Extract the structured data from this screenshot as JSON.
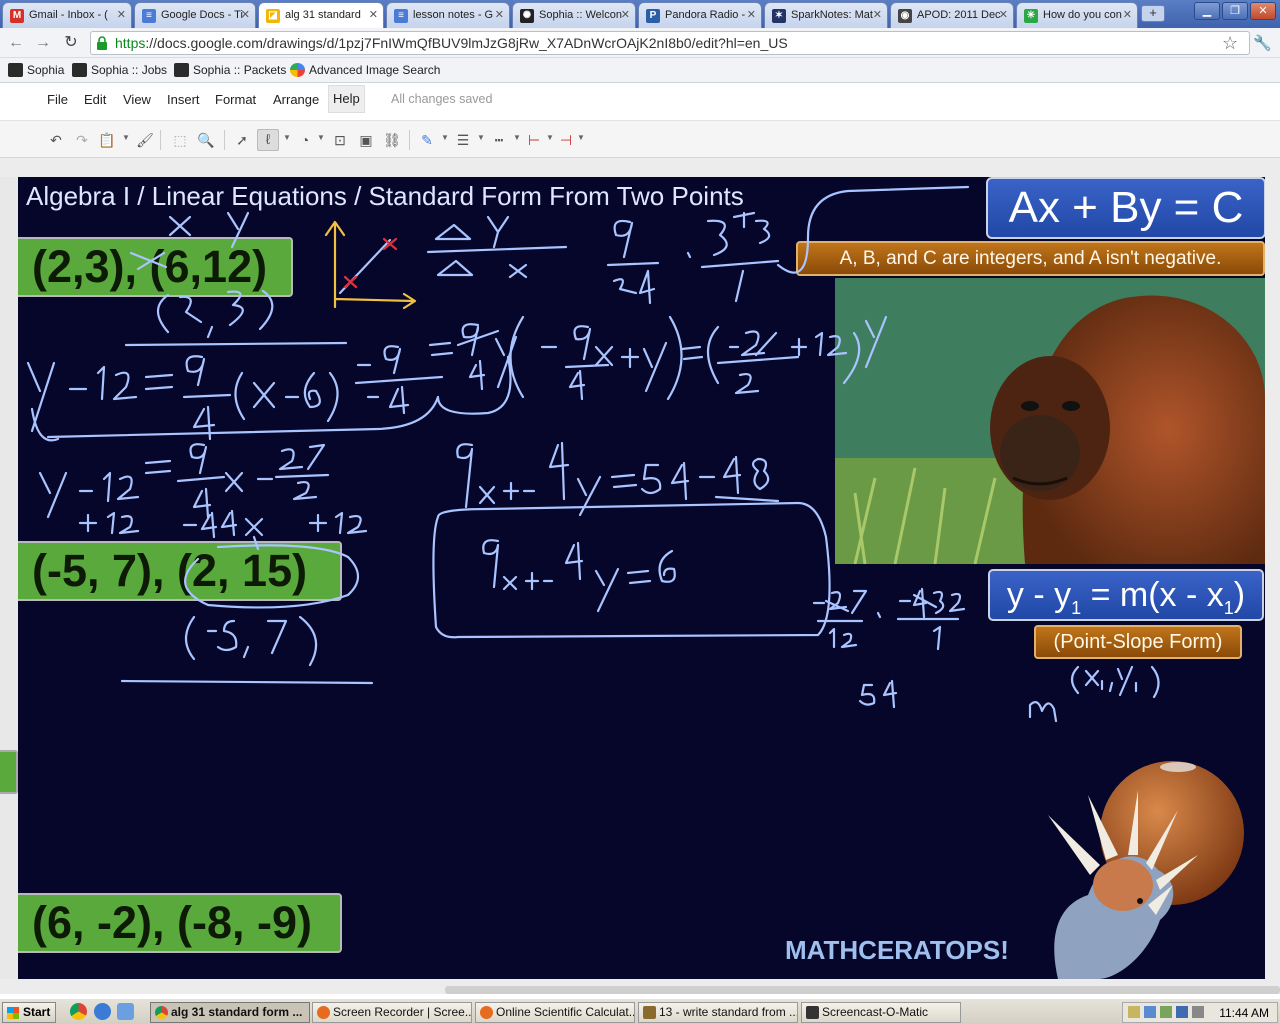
{
  "browser": {
    "tabs": [
      {
        "label": "Gmail - Inbox - (",
        "icon": "gmail-icon",
        "color": "#d93025"
      },
      {
        "label": "Google Docs - Ti",
        "icon": "google-docs-icon",
        "color": "#4a7bd8"
      },
      {
        "label": "alg 31 standard",
        "icon": "google-drawings-icon",
        "color": "#f2b705"
      },
      {
        "label": "lesson notes - G",
        "icon": "google-docs-icon",
        "color": "#4a7bd8"
      },
      {
        "label": "Sophia :: Welcon",
        "icon": "sophia-icon",
        "color": "#222222"
      },
      {
        "label": "Pandora Radio -",
        "icon": "pandora-icon",
        "color": "#2b5ea7"
      },
      {
        "label": "SparkNotes: Mat",
        "icon": "sparknotes-icon",
        "color": "#223366"
      },
      {
        "label": "APOD: 2011 Dec",
        "icon": "apod-icon",
        "color": "#444444"
      },
      {
        "label": "How do you con",
        "icon": "green-star-icon",
        "color": "#2aa845"
      }
    ],
    "url_https": "https",
    "url_rest": "://docs.google.com/drawings/d/1pzj7FnIWmQfBUV9lmJzG8jRw_X7ADnWcrOAjK2nI8b0/edit?hl=en_US",
    "bookmarks": [
      "Sophia",
      "Sophia :: Jobs",
      "Sophia :: Packets",
      "Advanced Image Search"
    ]
  },
  "menubar": {
    "items": [
      "File",
      "Edit",
      "View",
      "Insert",
      "Format",
      "Arrange",
      "Help"
    ],
    "status": "All changes saved"
  },
  "slide": {
    "title": "Algebra I / Linear Equations / Standard Form From Two Points",
    "points": [
      "(2,3), (6,12)",
      "(-5, 7), (2, 15)",
      "(6, -2), (-8, -9)"
    ],
    "standard_form": "Ax + By = C",
    "standard_note": "A, B, and C are integers, and A isn't negative.",
    "point_slope_main": "y - y",
    "point_slope_sub1": "1",
    "point_slope_mid": " = m(x - x",
    "point_slope_sub2": "1",
    "point_slope_end": ")",
    "point_slope_label": "(Point-Slope Form)",
    "brand": "MATHCERATOPS!"
  },
  "taskbar": {
    "start": "Start",
    "tasks": [
      "alg 31 standard form ...",
      "Screen Recorder | Scree...",
      "Online Scientific Calculat...",
      "13 - write standard from ...",
      "Screencast-O-Matic"
    ],
    "clock": "11:44 AM"
  },
  "colors": {
    "slide_bg": "#05062a",
    "point_green": "#5aa93c",
    "formula_blue": "#2a52b8",
    "note_orange": "#a85f12",
    "ink": "#a9c4ff"
  }
}
